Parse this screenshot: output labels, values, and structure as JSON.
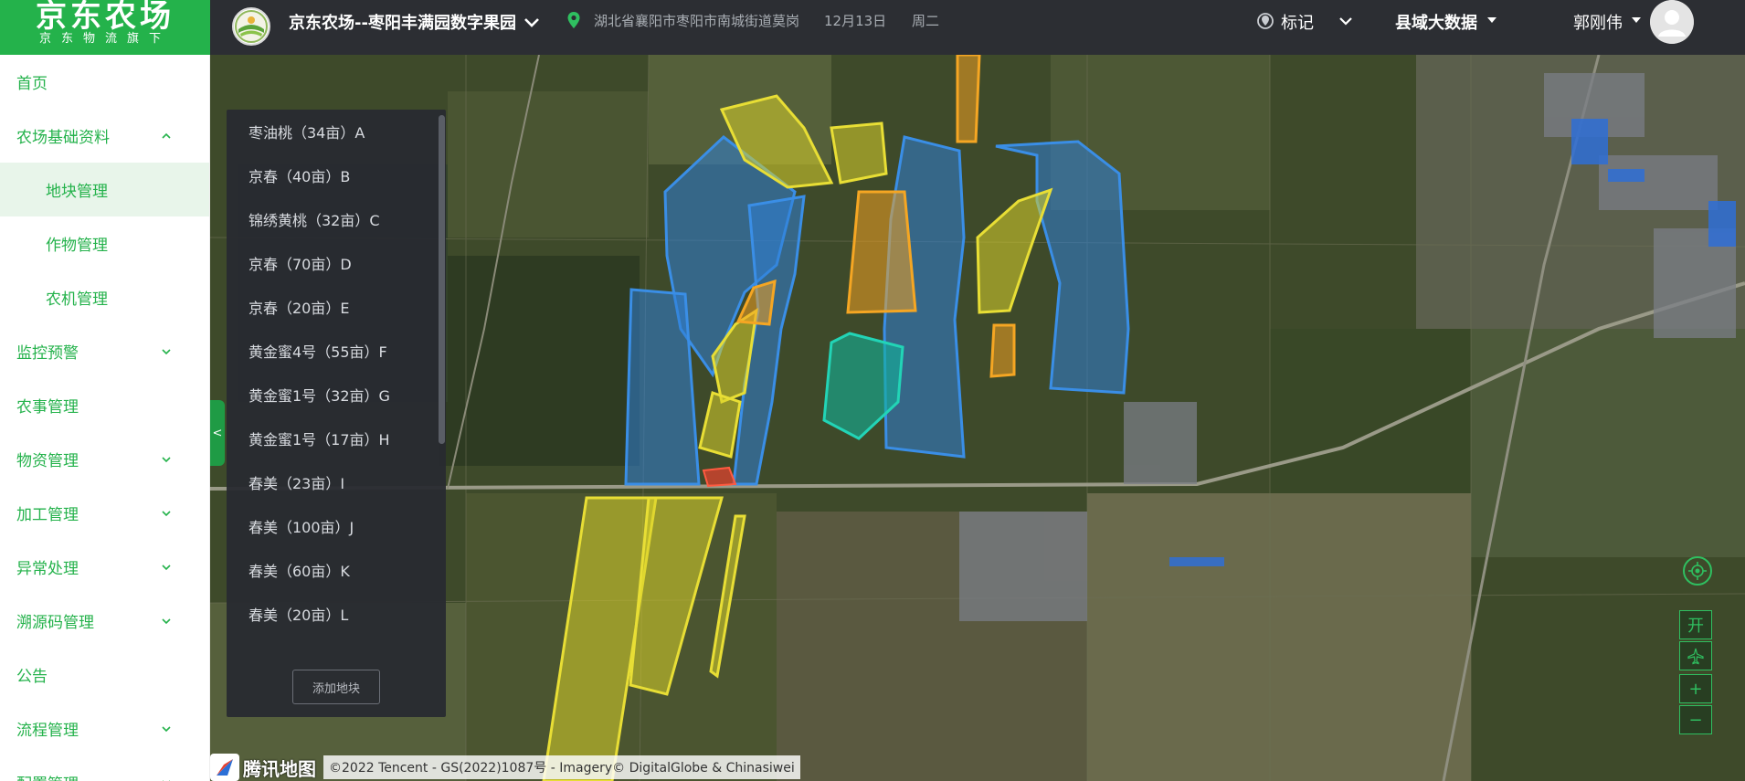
{
  "logo": {
    "title": "京东农场",
    "subtitle": "京东物流旗下"
  },
  "header": {
    "farm_name": "京东农场--枣阳丰满园数字果园",
    "location": "湖北省襄阳市枣阳市南城街道莫岗",
    "date": "12月13日",
    "weekday": "周二",
    "mark_label": "标记",
    "county_label": "县域大数据",
    "user_name": "郭刚伟"
  },
  "sidebar": {
    "items": [
      {
        "label": "首页"
      },
      {
        "label": "农场基础资料",
        "expanded": true
      },
      {
        "label": "地块管理",
        "active": true
      },
      {
        "label": "作物管理"
      },
      {
        "label": "农机管理"
      },
      {
        "label": "监控预警"
      },
      {
        "label": "农事管理"
      },
      {
        "label": "物资管理"
      },
      {
        "label": "加工管理"
      },
      {
        "label": "异常处理"
      },
      {
        "label": "溯源码管理"
      },
      {
        "label": "公告"
      },
      {
        "label": "流程管理"
      },
      {
        "label": "配置管理"
      }
    ]
  },
  "plots": {
    "items": [
      "枣油桃（34亩）A",
      "京春（40亩）B",
      "锦绣黄桃（32亩）C",
      "京春（70亩）D",
      "京春（20亩）E",
      "黄金蜜4号（55亩）F",
      "黄金蜜1号（32亩）G",
      "黄金蜜1号（17亩）H",
      "春美（23亩）I",
      "春美（100亩）J",
      "春美（60亩）K",
      "春美（20亩）L"
    ],
    "add_button": "添加地块",
    "collapse_symbol": "<"
  },
  "map_controls": {
    "open_label": "开",
    "zoom_in": "+",
    "zoom_out": "−"
  },
  "attribution": {
    "logo_text": "腾讯地图",
    "copyright": "©2022 Tencent - GS(2022)1087号 - Imagery© DigitalGlobe & Chinasiwei"
  },
  "colors": {
    "brand": "#24b24b",
    "topbar": "#2c2e33",
    "plot_blue": "#2f7fd6",
    "plot_yellow": "#d8d12a",
    "plot_orange": "#f0a020",
    "plot_teal": "#12b39a",
    "plot_red": "#e8412f"
  }
}
